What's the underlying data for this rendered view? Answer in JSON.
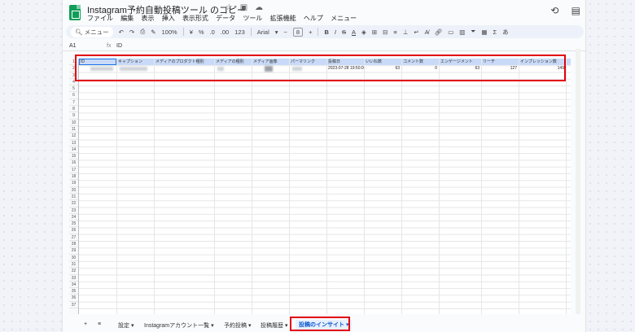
{
  "title": "Instagram予約自動投稿ツール のコピー",
  "menu": [
    "ファイル",
    "編集",
    "表示",
    "挿入",
    "表示形式",
    "データ",
    "ツール",
    "拡張機能",
    "ヘルプ",
    "メニュー"
  ],
  "toolbar": {
    "search": "メニュー",
    "zoom": "100%",
    "currency": "¥",
    "percent": "%",
    "decimal_dec": ".0",
    "decimal_inc": ".00",
    "format_123": "123",
    "font": "Arial",
    "font_size": "8"
  },
  "formula_bar": {
    "cell": "A1",
    "fx": "fx",
    "value": "ID"
  },
  "columns": [
    "ID",
    "キャプション",
    "メディアのプロダクト種別",
    "メディアの種別",
    "メディア画像",
    "パーマリンク",
    "投稿日",
    "いいね数",
    "コメント数",
    "エンゲージメント",
    "リーチ",
    "インプレッション数"
  ],
  "data_row": {
    "posted_at": "2023-07-28 19:50:00",
    "likes": "63",
    "comments": "0",
    "engagement": "63",
    "reach": "127",
    "impressions": "149"
  },
  "row_numbers": [
    "1",
    "2",
    "3",
    "4",
    "5",
    "6",
    "7",
    "8",
    "9",
    "10",
    "11",
    "12",
    "13",
    "14",
    "15",
    "16",
    "17",
    "18",
    "19",
    "20",
    "21",
    "22",
    "23",
    "24",
    "25",
    "26",
    "27",
    "28",
    "29",
    "30",
    "31",
    "32",
    "33",
    "34",
    "35",
    "36",
    "37"
  ],
  "sheets": {
    "add": "+",
    "list": "≡",
    "tabs": [
      "設定",
      "Instagramアカウント一覧",
      "予約投稿",
      "投稿履歴",
      "投稿のインサイト"
    ],
    "active": "投稿のインサイト"
  },
  "colors": {
    "highlight": "#e3000f",
    "header_fill": "#c9daf8",
    "sheets_green": "#0f9d58"
  }
}
